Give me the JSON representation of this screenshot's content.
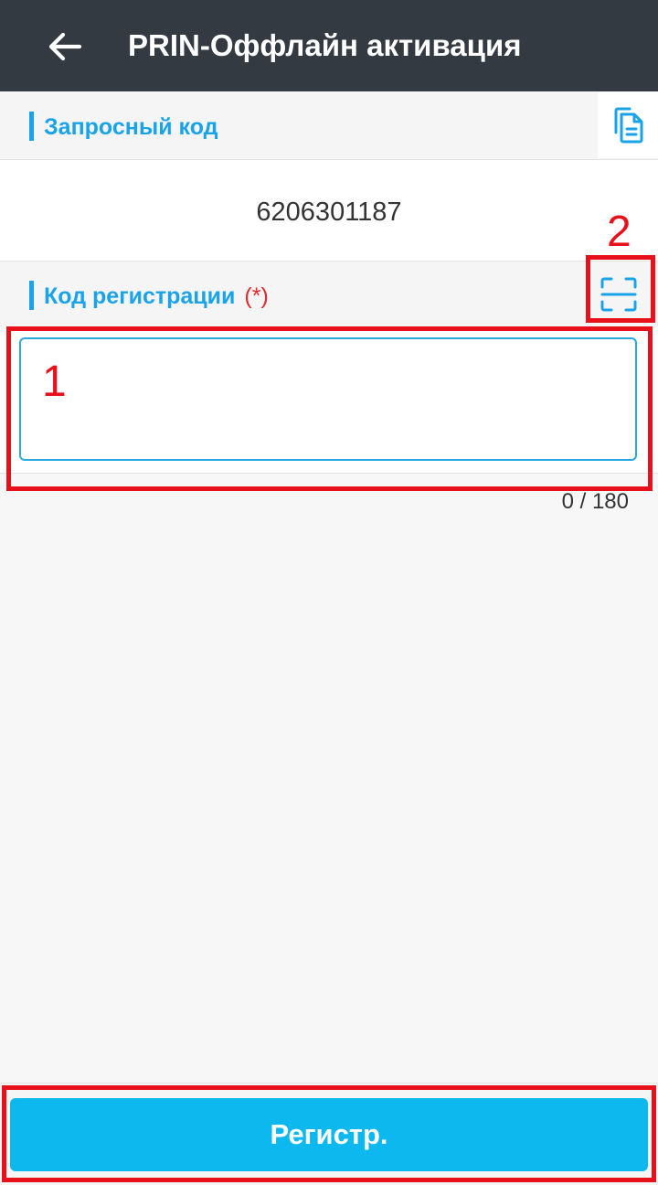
{
  "app_bar": {
    "title": "PRIN-Оффлайн активация",
    "back_icon": "arrow-left-icon"
  },
  "request_section": {
    "label": "Запросный код",
    "paste_icon": "document-copy-icon",
    "code_value": "6206301187"
  },
  "registration_section": {
    "label": "Код регистрации",
    "required_mark": "(*)",
    "scan_icon": "scan-icon",
    "input_value": "",
    "counter": "0 / 180"
  },
  "footer": {
    "register_label": "Регистр."
  },
  "annotations": {
    "box1_label": "1",
    "box2_label": "2"
  },
  "colors": {
    "app_bar_bg": "#343a42",
    "accent": "#1aa3e8",
    "button_bg": "#0db8ef",
    "required": "#e12a2a",
    "annotation": "#e8111b"
  }
}
